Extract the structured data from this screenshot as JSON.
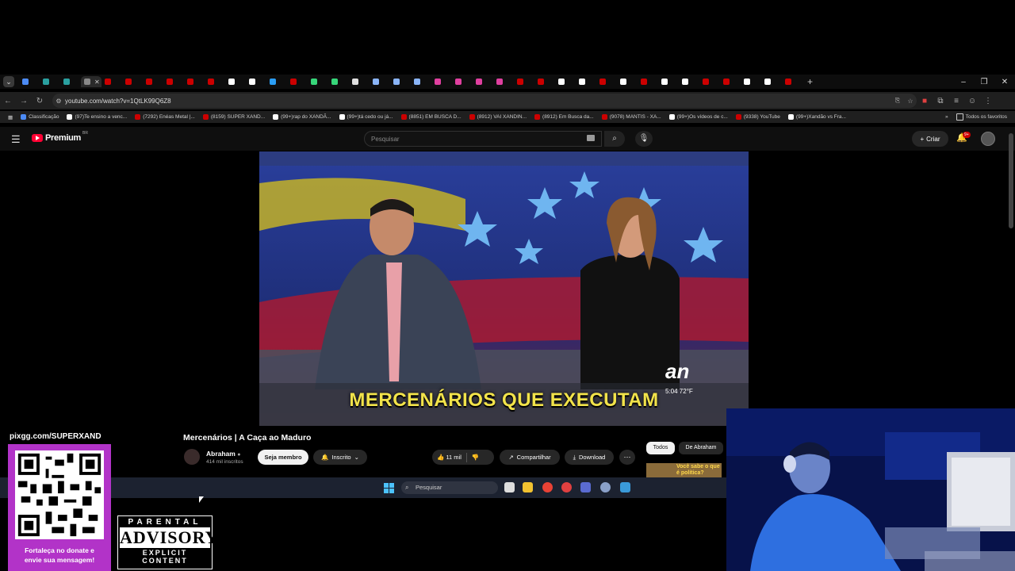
{
  "browser": {
    "url": "youtube.com/watch?v=1QtLK99Q6Z8",
    "tab_colors": [
      "#4c8bf5",
      "#2aa0a0",
      "#2aa0a0",
      "#888888",
      "#cc0000",
      "#cc0000",
      "#cc0000",
      "#cc0000",
      "#cc0000",
      "#cc0000",
      "#ffffff",
      "#ffffff",
      "#2a9df4",
      "#cc0000",
      "#37d67a",
      "#37d67a",
      "#e0e0e0",
      "#8ab4f8",
      "#8ab4f8",
      "#8ab4f8",
      "#e040a0",
      "#e040a0",
      "#e040a0",
      "#e040a0",
      "#cc0000",
      "#cc0000",
      "#ffffff",
      "#ffffff",
      "#cc0000",
      "#ffffff",
      "#cc0000",
      "#ffffff",
      "#ffffff",
      "#cc0000",
      "#cc0000",
      "#ffffff",
      "#ffffff",
      "#cc0000"
    ],
    "bookmarks": [
      {
        "label": "Classificação",
        "color": "#4c8bf5"
      },
      {
        "label": "(97)Te ensino a venc...",
        "color": "#ffffff"
      },
      {
        "label": "(7292) Enéas Metal |...",
        "color": "#cc0000"
      },
      {
        "label": "(8159) SUPER XAND...",
        "color": "#cc0000"
      },
      {
        "label": "(99+)rap do XANDÃ...",
        "color": "#ffffff"
      },
      {
        "label": "(99+)tá cedo ou já...",
        "color": "#ffffff"
      },
      {
        "label": "(8851) EM BUSCA D...",
        "color": "#cc0000"
      },
      {
        "label": "(8912) VAI XANDIN...",
        "color": "#cc0000"
      },
      {
        "label": "(8912) Em Busca da...",
        "color": "#cc0000"
      },
      {
        "label": "(9078) MANTIS - XA...",
        "color": "#cc0000"
      },
      {
        "label": "(99+)Os vídeos de c...",
        "color": "#ffffff"
      },
      {
        "label": "(9338) YouTube",
        "color": "#cc0000"
      },
      {
        "label": "(99+)Xandão vs Fra...",
        "color": "#ffffff"
      }
    ],
    "all_bookmarks": "Todos os favoritos"
  },
  "youtube": {
    "logo": "Premium",
    "region": "BR",
    "search_placeholder": "Pesquisar",
    "create": "Criar",
    "notifications": "9+",
    "video": {
      "caption": "MERCENÁRIOS QUE EXECUTAM",
      "channel_logo": "an",
      "temperature": "5:04 72°F",
      "title": "Mercenários | A Caça ao Maduro"
    },
    "channel": {
      "name": "Abraham",
      "subscribers": "414 mil inscritos"
    },
    "buttons": {
      "member": "Seja membro",
      "subscribed": "Inscrito",
      "likes": "11 mil",
      "share": "Compartilhar",
      "download": "Download"
    },
    "chips": {
      "all": "Todos",
      "from": "De Abraham"
    },
    "recommendation_text": "Você sabe o que é política?"
  },
  "taskbar": {
    "search_placeholder": "Pesquisar"
  },
  "overlay": {
    "pix_url": "pixgg.com/SUPERXAND",
    "donate_text_1": "Fortaleça no donate e",
    "donate_text_2": "envie sua mensagem!",
    "advisory_top": "PARENTAL",
    "advisory_mid": "ADVISORY",
    "advisory_bottom": "EXPLICIT CONTENT"
  }
}
